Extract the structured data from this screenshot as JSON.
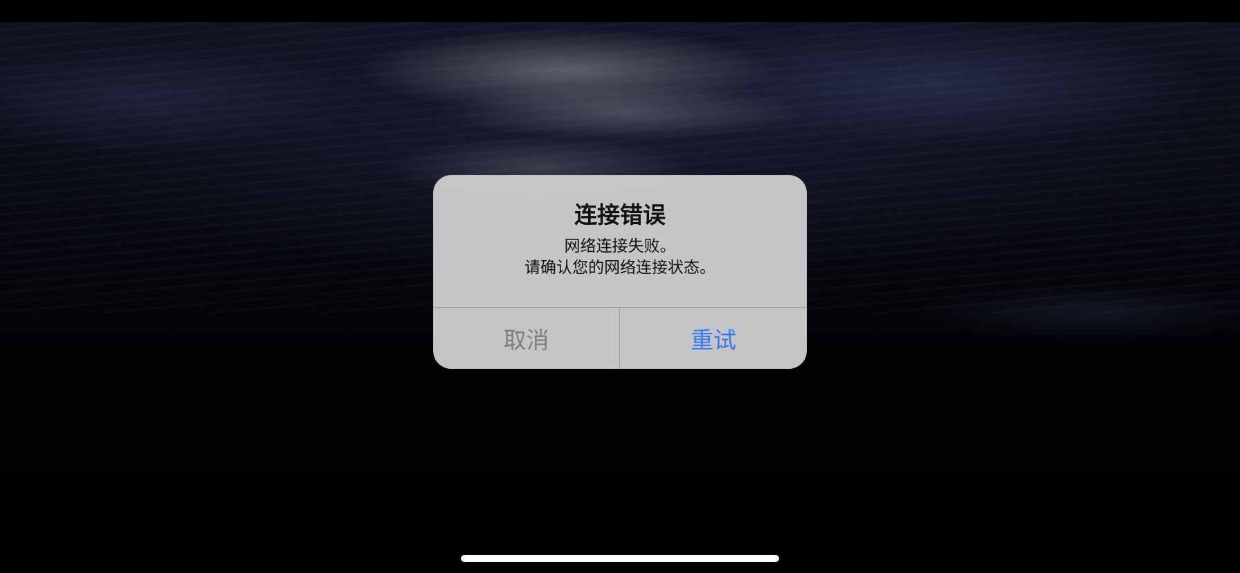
{
  "alert": {
    "title": "连接错误",
    "message_line1": "网络连接失败。",
    "message_line2": "请确认您的网络连接状态。",
    "cancel_label": "取消",
    "retry_label": "重试"
  },
  "colors": {
    "alert_background": "#cdcdcf",
    "primary_action": "#3478f6",
    "cancel_action": "#7d7d80",
    "home_indicator": "#ffffff"
  }
}
